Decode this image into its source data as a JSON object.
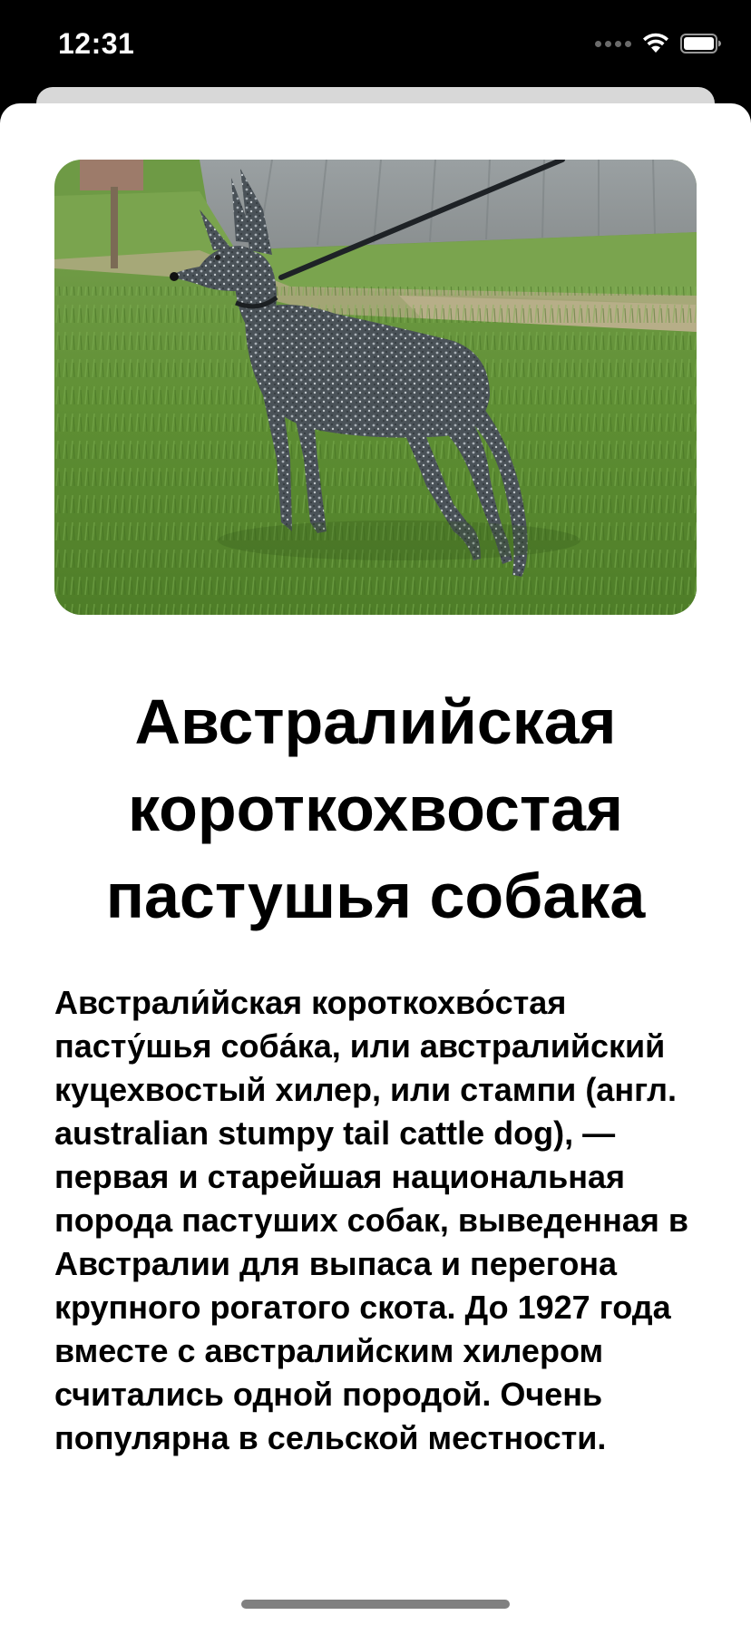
{
  "status_bar": {
    "time": "12:31",
    "icons": [
      "cellular-signal-icon",
      "wifi-icon",
      "battery-icon"
    ]
  },
  "hero_image": {
    "alt": "Австралийская короткохвостая пастушья собака",
    "subject": "dog-photo"
  },
  "breed": {
    "title": "Австралийская короткохвостая пастушья собака",
    "description": "Австрали́йская короткохво́стая пасту́шья соба́ка, или австралийский куцехвостый хилер, или стампи (англ. australian stumpy tail cattle dog), — первая и старейшая национальная порода пастуших собак, выведенная в Австралии для выпаса и перегона крупного рогатого скота. До 1927 года вместе с австралийским хилером считались одной породой. Очень популярна в сельской местности."
  },
  "colors": {
    "background": "#ffffff",
    "status_bar": "#000000",
    "text": "#000000",
    "back_sheet": "#d8d8d8",
    "home_indicator": "#808080"
  }
}
